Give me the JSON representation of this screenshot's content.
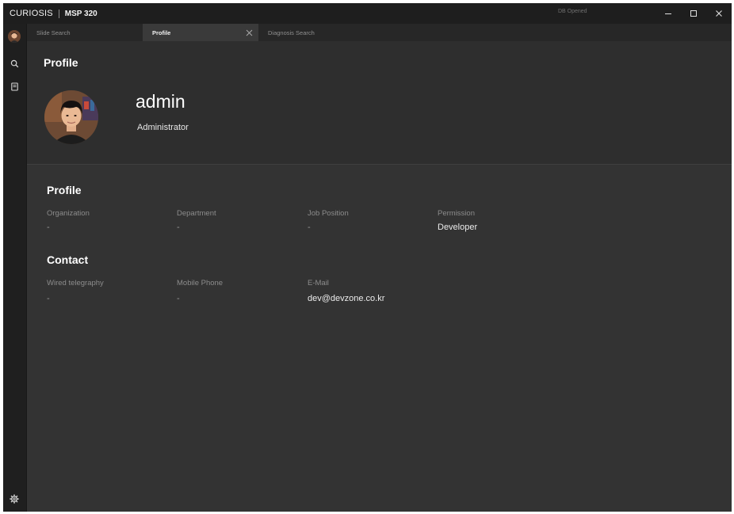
{
  "app": {
    "brand_name": "CURIOSIS",
    "product_name": "MSP 320",
    "db_status": "DB Opened"
  },
  "tabs": [
    {
      "label": "Slide Search",
      "active": false
    },
    {
      "label": "Profile",
      "active": true
    },
    {
      "label": "Diagnosis Search",
      "active": false
    }
  ],
  "header": {
    "page_title": "Profile",
    "username": "admin",
    "role": "Administrator"
  },
  "profile_section": {
    "title": "Profile",
    "fields": [
      {
        "label": "Organization",
        "value": "-"
      },
      {
        "label": "Department",
        "value": "-"
      },
      {
        "label": "Job Position",
        "value": "-"
      },
      {
        "label": "Permission",
        "value": "Developer"
      }
    ]
  },
  "contact_section": {
    "title": "Contact",
    "fields": [
      {
        "label": "Wired telegraphy",
        "value": "-"
      },
      {
        "label": "Mobile Phone",
        "value": "-"
      },
      {
        "label": "E-Mail",
        "value": "dev@devzone.co.kr"
      }
    ]
  },
  "icons": {
    "rail": [
      "avatar",
      "search-icon",
      "document-icon",
      "gear-icon"
    ],
    "window": [
      "minimize-icon",
      "maximize-icon",
      "close-icon"
    ]
  },
  "colors": {
    "titlebar": "#1e1e1e",
    "rail": "#1f1f1f",
    "content": "#333333",
    "active_tab": "#3a3a3a"
  }
}
